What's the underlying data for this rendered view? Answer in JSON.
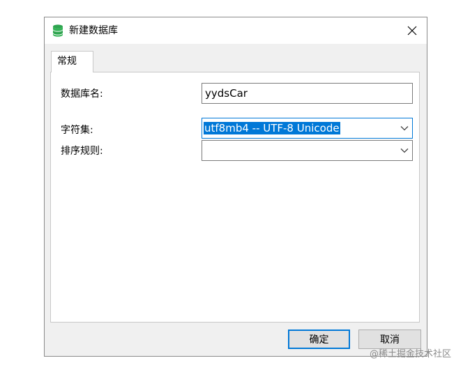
{
  "window": {
    "title": "新建数据库"
  },
  "tabs": [
    {
      "label": "常规",
      "active": true
    }
  ],
  "form": {
    "db_name_label": "数据库名:",
    "db_name_value": "yydsCar",
    "charset_label": "字符集:",
    "charset_value": "utf8mb4 -- UTF-8 Unicode",
    "collation_label": "排序规则:",
    "collation_value": ""
  },
  "buttons": {
    "ok_label": "确定",
    "cancel_label": "取消"
  },
  "watermark": "@稀土掘金技术社区",
  "colors": {
    "accent": "#0078d7",
    "app_icon": "#2ea44f",
    "dialog_bg": "#f0f0f0"
  },
  "icons": {
    "app": "database-icon",
    "close": "close-icon",
    "dropdown": "chevron-down-icon"
  }
}
